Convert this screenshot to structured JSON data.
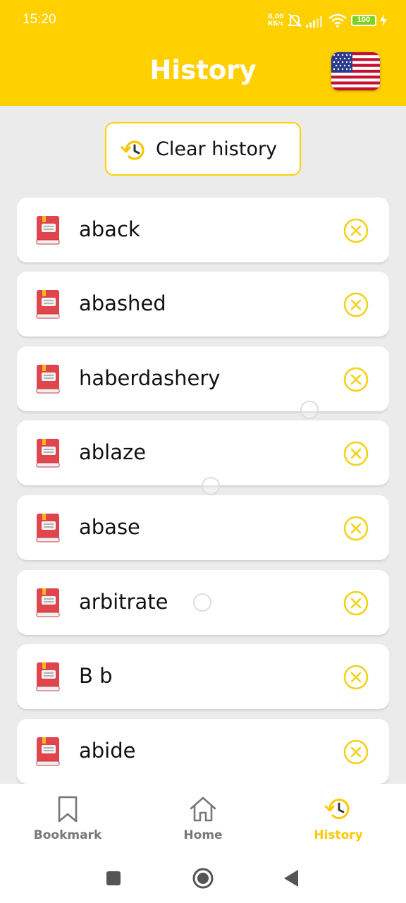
{
  "status_bar": {
    "time": "15:20",
    "net_speed": "0,00",
    "net_unit": "КБ/с",
    "battery": "100"
  },
  "header": {
    "title": "History",
    "language_flag": "us-flag-icon"
  },
  "clear_button": {
    "label": "Clear history",
    "icon": "history-icon"
  },
  "history": {
    "items": [
      {
        "word": "aback"
      },
      {
        "word": "abashed"
      },
      {
        "word": "haberdashery"
      },
      {
        "word": "ablaze"
      },
      {
        "word": "abase"
      },
      {
        "word": "arbitrate"
      },
      {
        "word": "B b"
      },
      {
        "word": "abide"
      }
    ]
  },
  "bottom_nav": {
    "items": [
      {
        "label": "Bookmark",
        "icon": "bookmark-icon",
        "active": false
      },
      {
        "label": "Home",
        "icon": "home-icon",
        "active": false
      },
      {
        "label": "History",
        "icon": "history-icon",
        "active": true
      }
    ]
  },
  "colors": {
    "accent": "#ffd000",
    "book": "#e0444c",
    "delete": "#f2d21a",
    "inactive": "#777777"
  }
}
